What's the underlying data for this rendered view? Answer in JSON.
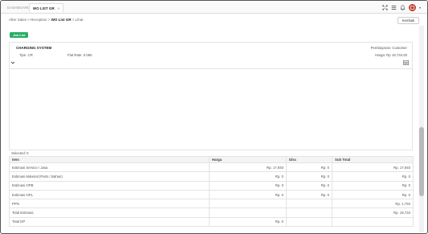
{
  "tabs": [
    {
      "label": "DASHBOARD",
      "active": false
    },
    {
      "label": "WO LIST GR",
      "active": true,
      "close": "×"
    }
  ],
  "breadcrumb": {
    "part1": "After Sales",
    "sep": ">",
    "part2": "Reception",
    "part3": "WO List GR",
    "part4": "Lihat"
  },
  "buttons": {
    "kembali": "Kembali"
  },
  "badge": "Job List",
  "card": {
    "title": "CHARGING SYSTEM",
    "pembayaran": "Pembayaran: Customer",
    "tipe": "Tipe: CR",
    "flat_rate": "Flat Rate: 0.065",
    "harga": "Harga: Rp 19,734.00"
  },
  "selected_text": "Selected: 0",
  "table": {
    "headers": [
      "Item",
      "Harga",
      "Disc",
      "Sub Total"
    ],
    "rows": [
      [
        "Estimasi Service / Jasa",
        "Rp. 17,940",
        "Rp. 0",
        "Rp. 17,940"
      ],
      [
        "Estimasi Material (Parts / Bahan)",
        "Rp. 0",
        "Rp. 0",
        "Rp. 0"
      ],
      [
        "Estimasi OPB",
        "Rp. 0",
        "Rp. 0",
        "Rp. 0"
      ],
      [
        "Estimasi OPL",
        "Rp. 0",
        "Rp. 0",
        "Rp. 0"
      ],
      [
        "PPN",
        "",
        "",
        "Rp. 1,794"
      ],
      [
        "Total Estimasi",
        "",
        "",
        "Rp. 19,734"
      ],
      [
        "Total DP",
        "Rp. 0",
        "",
        ""
      ]
    ]
  },
  "colors": {
    "badge": "#27ae60",
    "avatar": "#c0392b"
  },
  "icons": [
    "expand-icon",
    "menu-icon",
    "bell-icon",
    "avatar-icon",
    "chevron-down-icon",
    "grid-icon"
  ]
}
